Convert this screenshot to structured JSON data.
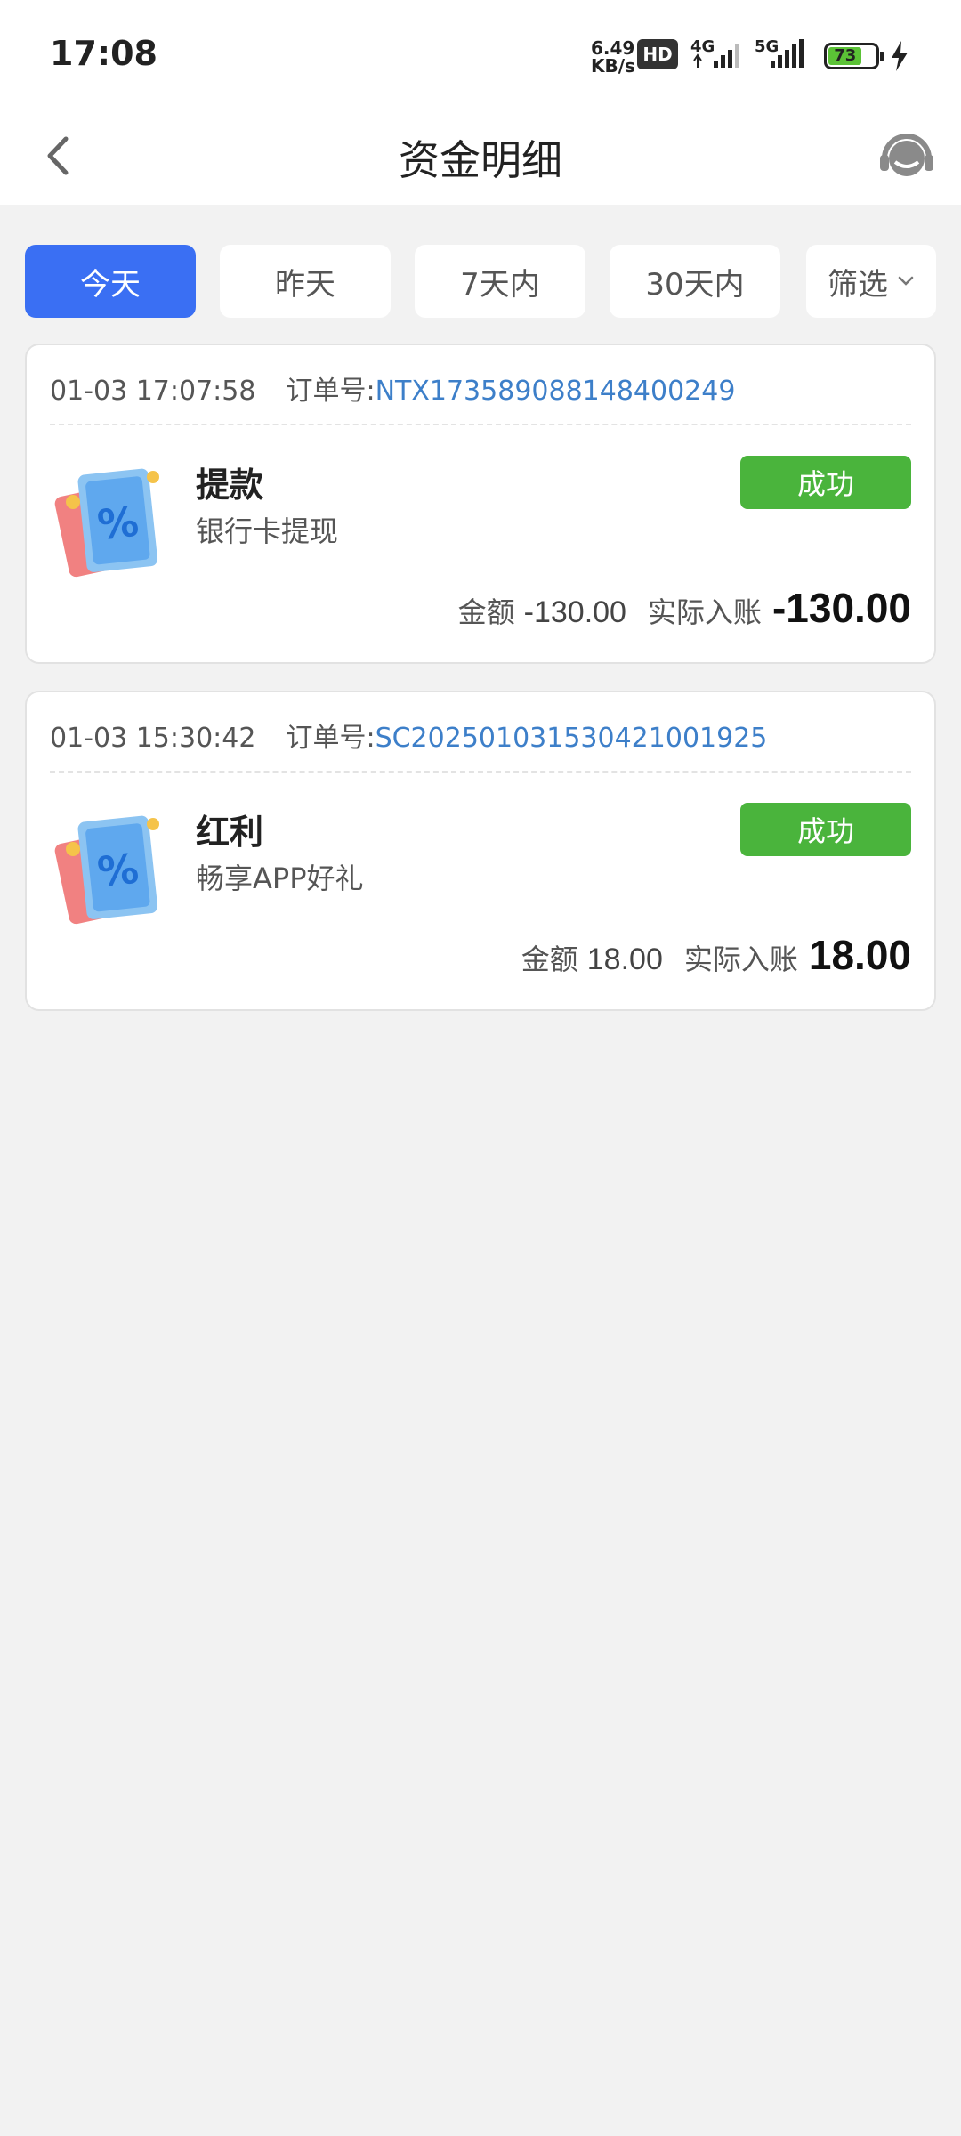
{
  "status_bar": {
    "time": "17:08",
    "net_speed_value": "6.49",
    "net_speed_unit": "KB/s",
    "hd_label": "HD",
    "signal_1_label": "4G",
    "signal_2_label": "5G",
    "battery_level": "73",
    "battery_color": "#5bc236"
  },
  "nav": {
    "title": "资金明细",
    "back_icon": "chevron-left-icon",
    "support_icon": "headset-icon"
  },
  "tabs": [
    {
      "label": "今天",
      "active": true
    },
    {
      "label": "昨天",
      "active": false
    },
    {
      "label": "7天内",
      "active": false
    },
    {
      "label": "30天内",
      "active": false
    },
    {
      "label": "筛选",
      "active": false
    }
  ],
  "accent_color": "#3a6ff3",
  "records": [
    {
      "datetime": "01-03 17:07:58",
      "order_label": "订单号:",
      "order_no": "NTX173589088148400249",
      "title": "提款",
      "subtitle": "银行卡提现",
      "status": "成功",
      "amount_label": "金额",
      "amount": "-130.00",
      "actual_label": "实际入账",
      "actual_amount": "-130.00"
    },
    {
      "datetime": "01-03 15:30:42",
      "order_label": "订单号:",
      "order_no": "SC2025010315304210019 25",
      "title": "红利",
      "subtitle": "畅享APP好礼",
      "status": "成功",
      "amount_label": "金额",
      "amount": "18.00",
      "actual_label": "实际入账",
      "actual_amount": "18.00"
    }
  ],
  "status_color": "#4ab43c",
  "order_no_color": "#3d7fc9"
}
